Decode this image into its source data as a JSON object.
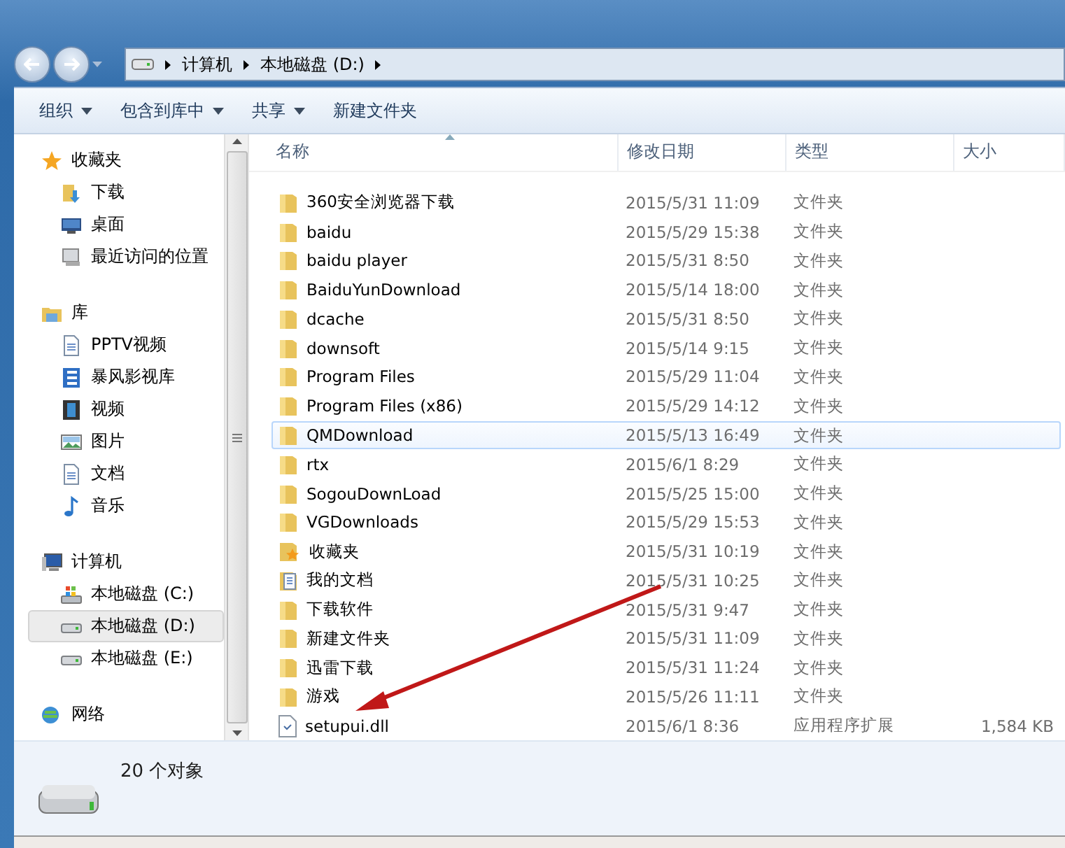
{
  "address_bar": {
    "crumbs": [
      "计算机",
      "本地磁盘 (D:)"
    ]
  },
  "toolbar": [
    {
      "label": "组织",
      "dropdown": true
    },
    {
      "label": "包含到库中",
      "dropdown": true
    },
    {
      "label": "共享",
      "dropdown": true
    },
    {
      "label": "新建文件夹",
      "dropdown": false
    }
  ],
  "sidebar": {
    "groups": [
      {
        "label": "收藏夹",
        "children": [
          {
            "label": "下载",
            "selected": false
          },
          {
            "label": "桌面",
            "selected": false
          },
          {
            "label": "最近访问的位置",
            "selected": false
          }
        ]
      },
      {
        "label": "库",
        "children": [
          {
            "label": "PPTV视频",
            "selected": false
          },
          {
            "label": "暴风影视库",
            "selected": false
          },
          {
            "label": "视频",
            "selected": false
          },
          {
            "label": "图片",
            "selected": false
          },
          {
            "label": "文档",
            "selected": false
          },
          {
            "label": "音乐",
            "selected": false
          }
        ]
      },
      {
        "label": "计算机",
        "children": [
          {
            "label": "本地磁盘 (C:)",
            "selected": false
          },
          {
            "label": "本地磁盘 (D:)",
            "selected": true
          },
          {
            "label": "本地磁盘 (E:)",
            "selected": false
          }
        ]
      },
      {
        "label": "网络"
      }
    ]
  },
  "table": {
    "columns": [
      "名称",
      "修改日期",
      "类型",
      "大小"
    ],
    "rows": [
      {
        "kind": "folder",
        "name": "360安全浏览器下载",
        "date": "2015/5/31 11:09",
        "type": "文件夹",
        "highlighted": false
      },
      {
        "kind": "folder",
        "name": "baidu",
        "date": "2015/5/29 15:38",
        "type": "文件夹",
        "highlighted": false
      },
      {
        "kind": "folder",
        "name": "baidu player",
        "date": "2015/5/31 8:50",
        "type": "文件夹",
        "highlighted": false
      },
      {
        "kind": "folder",
        "name": "BaiduYunDownload",
        "date": "2015/5/14 18:00",
        "type": "文件夹",
        "highlighted": false
      },
      {
        "kind": "folder",
        "name": "dcache",
        "date": "2015/5/31 8:50",
        "type": "文件夹",
        "highlighted": false
      },
      {
        "kind": "folder",
        "name": "downsoft",
        "date": "2015/5/14 9:15",
        "type": "文件夹",
        "highlighted": false
      },
      {
        "kind": "folder",
        "name": "Program Files",
        "date": "2015/5/29 11:04",
        "type": "文件夹",
        "highlighted": false
      },
      {
        "kind": "folder",
        "name": "Program Files (x86)",
        "date": "2015/5/29 14:12",
        "type": "文件夹",
        "highlighted": false
      },
      {
        "kind": "folder",
        "name": "QMDownload",
        "date": "2015/5/13 16:49",
        "type": "文件夹",
        "highlighted": true
      },
      {
        "kind": "folder",
        "name": "rtx",
        "date": "2015/6/1 8:29",
        "type": "文件夹",
        "highlighted": false
      },
      {
        "kind": "folder",
        "name": "SogouDownLoad",
        "date": "2015/5/25 15:00",
        "type": "文件夹",
        "highlighted": false
      },
      {
        "kind": "folder",
        "name": "VGDownloads",
        "date": "2015/5/29 15:53",
        "type": "文件夹",
        "highlighted": false
      },
      {
        "kind": "favorites",
        "name": "收藏夹",
        "date": "2015/5/31 10:19",
        "type": "文件夹",
        "highlighted": false
      },
      {
        "kind": "documents",
        "name": "我的文档",
        "date": "2015/5/31 10:25",
        "type": "文件夹",
        "highlighted": false
      },
      {
        "kind": "folder",
        "name": "下载软件",
        "date": "2015/5/31 9:47",
        "type": "文件夹",
        "highlighted": false
      },
      {
        "kind": "folder",
        "name": "新建文件夹",
        "date": "2015/5/31 11:09",
        "type": "文件夹",
        "highlighted": false
      },
      {
        "kind": "folder",
        "name": "迅雷下载",
        "date": "2015/5/31 11:24",
        "type": "文件夹",
        "highlighted": false
      },
      {
        "kind": "folder",
        "name": "游戏",
        "date": "2015/5/26 11:11",
        "type": "文件夹",
        "highlighted": false
      },
      {
        "kind": "file",
        "name": "setupui.dll",
        "date": "2015/6/1 8:36",
        "type": "应用程序扩展",
        "size": "1,584 KB",
        "highlighted": false
      }
    ]
  },
  "status_bar": {
    "text": "20 个对象"
  }
}
